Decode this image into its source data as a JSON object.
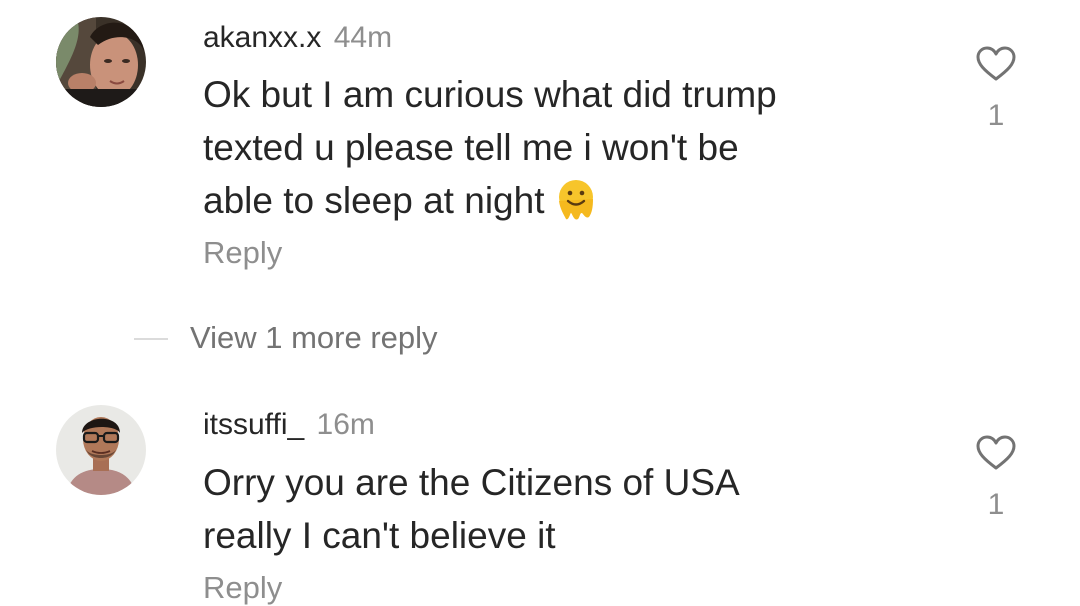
{
  "comments": [
    {
      "username": "akanxx.x",
      "time": "44m",
      "text_lines": [
        "Ok but I am curious what did trump",
        "texted u please tell  me i won't be",
        "able to sleep at night"
      ],
      "emoji": "melting-face-emoji",
      "reply_label": "Reply",
      "like_count": "1",
      "like_icon": "heart-outline-icon"
    },
    {
      "username": "itssuffi_",
      "time": "16m",
      "text_lines": [
        "Orry you are the Citizens of USA",
        "really I can't believe it"
      ],
      "reply_label": "Reply",
      "like_count": "1",
      "like_icon": "heart-outline-icon"
    }
  ],
  "view_more_replies": "View 1 more reply",
  "colors": {
    "text_primary": "#262626",
    "text_secondary": "#8e8e8e",
    "divider": "#dbdbdb"
  }
}
